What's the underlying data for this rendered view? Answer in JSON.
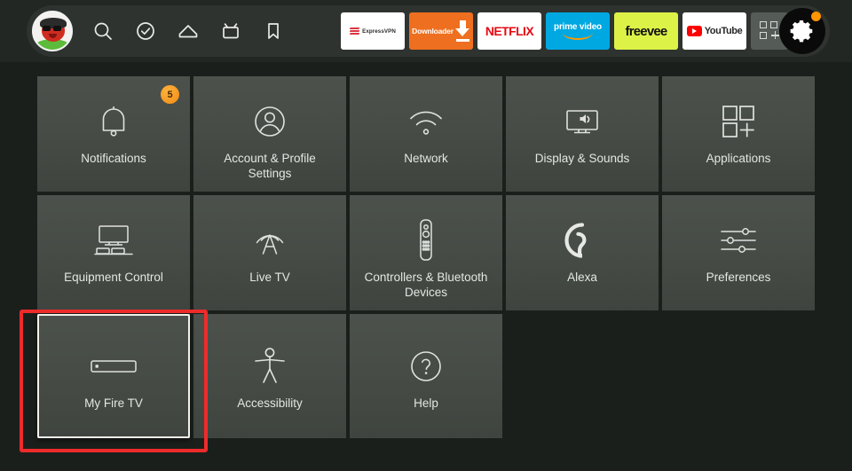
{
  "topbar": {
    "avatar": {
      "name": "user-avatar"
    },
    "nav_items": [
      {
        "id": "search",
        "icon": "search-icon",
        "label": "Search"
      },
      {
        "id": "watchlist",
        "icon": "check-circle-icon",
        "label": "Watchlist"
      },
      {
        "id": "home",
        "icon": "home-icon",
        "label": "Home"
      },
      {
        "id": "live",
        "icon": "live-tv-icon",
        "label": "Live TV"
      },
      {
        "id": "bookmark",
        "icon": "bookmark-icon",
        "label": "Library"
      }
    ],
    "apps": [
      {
        "id": "expressvpn",
        "label": "ExpressVPN",
        "bg": "#ffffff",
        "fg": "#2a2a2a"
      },
      {
        "id": "downloader",
        "label": "Downloader",
        "bg": "#ee6f1f",
        "fg": "#ffffff"
      },
      {
        "id": "netflix",
        "label": "NETFLIX",
        "bg": "#ffffff",
        "fg": "#e50914"
      },
      {
        "id": "primevideo",
        "label": "prime video",
        "bg": "#00a8e1",
        "fg": "#ffffff"
      },
      {
        "id": "freevee",
        "label": "freevee",
        "bg": "#ddf247",
        "fg": "#111111"
      },
      {
        "id": "youtube",
        "label": "YouTube",
        "bg": "#ffffff",
        "fg": "#282828"
      }
    ],
    "apps_more": {
      "icon": "apps-grid-plus-icon",
      "label": "All Apps"
    },
    "settings_button": {
      "icon": "gear-icon",
      "label": "Settings",
      "selected": true,
      "notification_dot": true,
      "dot_color": "#ff9500"
    }
  },
  "settings_grid": {
    "rows": [
      [
        {
          "id": "notifications",
          "label": "Notifications",
          "icon": "bell-icon",
          "badge": "5"
        },
        {
          "id": "account",
          "label": "Account & Profile Settings",
          "icon": "person-circle-icon"
        },
        {
          "id": "network",
          "label": "Network",
          "icon": "wifi-icon"
        },
        {
          "id": "display",
          "label": "Display & Sounds",
          "icon": "tv-speaker-icon"
        },
        {
          "id": "applications",
          "label": "Applications",
          "icon": "apps-grid-plus-icon"
        }
      ],
      [
        {
          "id": "equipment",
          "label": "Equipment Control",
          "icon": "tv-equipment-icon"
        },
        {
          "id": "livetv",
          "label": "Live TV",
          "icon": "broadcast-tower-icon"
        },
        {
          "id": "controllers",
          "label": "Controllers & Bluetooth Devices",
          "icon": "remote-control-icon"
        },
        {
          "id": "alexa",
          "label": "Alexa",
          "icon": "alexa-ring-icon"
        },
        {
          "id": "preferences",
          "label": "Preferences",
          "icon": "sliders-icon"
        }
      ],
      [
        {
          "id": "myfiretv",
          "label": "My Fire TV",
          "icon": "fire-tv-stick-icon",
          "focused": true
        },
        {
          "id": "accessibility",
          "label": "Accessibility",
          "icon": "accessibility-person-icon"
        },
        {
          "id": "help",
          "label": "Help",
          "icon": "question-circle-icon"
        }
      ]
    ]
  },
  "annotation": {
    "type": "highlight-rectangle",
    "color": "#ee2b2b",
    "target": "My Fire TV"
  },
  "colors": {
    "page_background": "#1b1f1c",
    "topbar_background": "#232724",
    "tile_background": "#474c47",
    "text": "#e4e7e3",
    "badge": "#f08a15",
    "focus_border": "#f3f1ea",
    "annotation": "#ee2b2b"
  }
}
